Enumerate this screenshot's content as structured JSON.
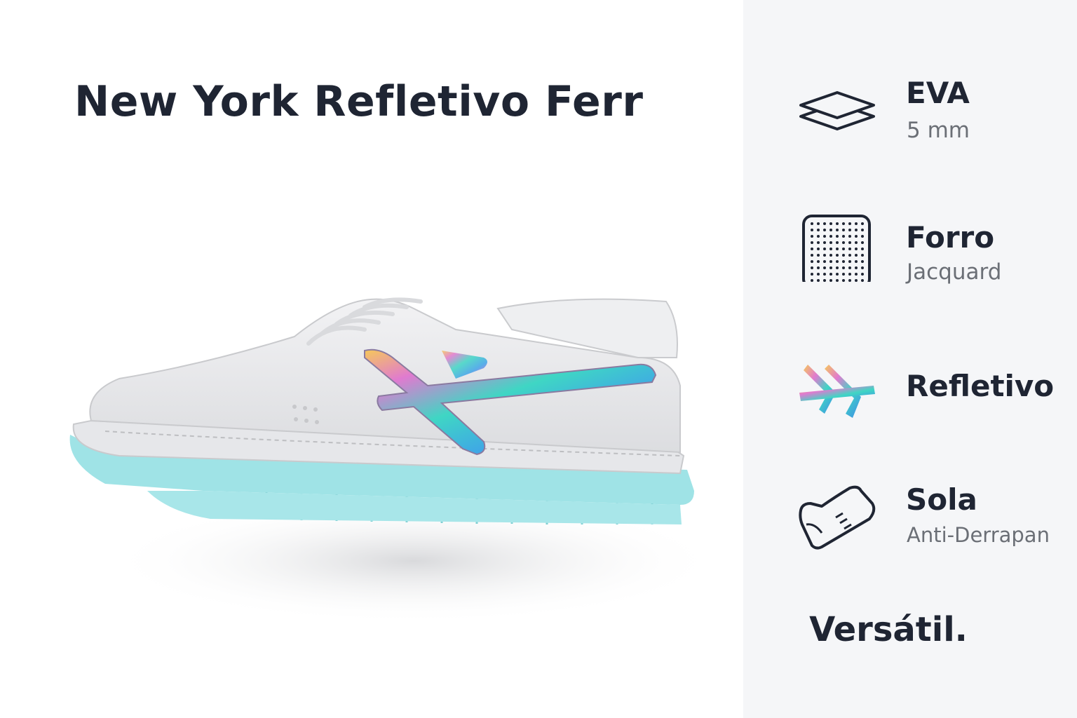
{
  "product": {
    "title": "New York Refletivo Ferr"
  },
  "features": [
    {
      "label": "EVA",
      "sub": "5 mm",
      "icon": "layers-icon"
    },
    {
      "label": "Forro",
      "sub": "Jacquard",
      "icon": "mesh-fabric-icon"
    },
    {
      "label": "Refletivo",
      "icon": "reflective-logo-icon"
    },
    {
      "label": "Sola",
      "sub": "Anti-Derrapan",
      "icon": "shoe-sole-icon"
    }
  ],
  "tagline": "Versátil.",
  "colors": {
    "text": "#1f2533",
    "subtext": "#6b6f76",
    "sidebar_bg": "#f5f6f8",
    "sole": "#9fe3e6"
  }
}
